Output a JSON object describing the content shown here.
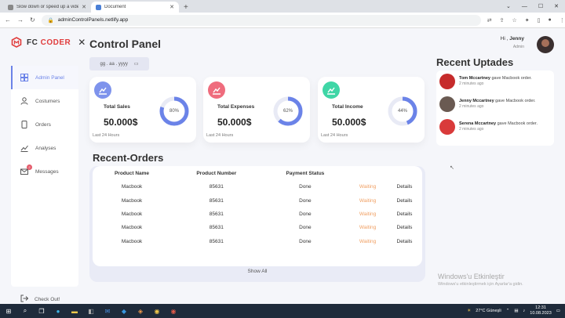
{
  "browser": {
    "tabs": [
      {
        "title": "Slow down or speed up a video"
      },
      {
        "title": "Document"
      }
    ],
    "url": "adminControlPanels.netlify.app"
  },
  "brand": {
    "name_main": "FC ",
    "name_accent": "CODER",
    "close": "✕"
  },
  "sidebar": {
    "items": [
      {
        "label": "Admin Panel"
      },
      {
        "label": "Costumers"
      },
      {
        "label": "Orders"
      },
      {
        "label": "Analyses"
      },
      {
        "label": "Messages",
        "badge": "2"
      }
    ],
    "checkout": "Check Out!"
  },
  "header": {
    "title": "Control Panel",
    "date_placeholder": "gg . aa . yyyy",
    "greeting": "Hi ,",
    "user_name": "Jenny",
    "user_role": "Admin"
  },
  "cards": [
    {
      "label": "Total Sales",
      "value": "50.000$",
      "percent": 80,
      "percent_text": "80%",
      "footer": "Last 24 Hours",
      "color": "#6b83e8",
      "icon_bg": "#7e93ec"
    },
    {
      "label": "Total Expenses",
      "value": "50.000$",
      "percent": 62,
      "percent_text": "62%",
      "footer": "Last 24 Hours",
      "color": "#6b83e8",
      "icon_bg": "#ef6c7d"
    },
    {
      "label": "Total Income",
      "value": "50.000$",
      "percent": 44,
      "percent_text": "44%",
      "footer": "Last 24 Hours",
      "color": "#6b83e8",
      "icon_bg": "#3fd6a6"
    }
  ],
  "orders": {
    "title": "Recent-Orders",
    "headers": [
      "Product Name",
      "Product Number",
      "Payment Status",
      "",
      ""
    ],
    "rows": [
      {
        "name": "Macbook",
        "number": "85631",
        "payment": "Done",
        "status": "Waiting",
        "action": "Details"
      },
      {
        "name": "Macbook",
        "number": "85631",
        "payment": "Done",
        "status": "Waiting",
        "action": "Details"
      },
      {
        "name": "Macbook",
        "number": "85631",
        "payment": "Done",
        "status": "Waiting",
        "action": "Details"
      },
      {
        "name": "Macbook",
        "number": "85631",
        "payment": "Done",
        "status": "Waiting",
        "action": "Details"
      },
      {
        "name": "Macbook",
        "number": "85631",
        "payment": "Done",
        "status": "Waiting",
        "action": "Details"
      }
    ],
    "show_all": "Show All"
  },
  "recent": {
    "title": "Recent Uptades",
    "updates": [
      {
        "name": "Tom Mccartney",
        "text": " gave Macbook order.",
        "time": "2 minutes ago"
      },
      {
        "name": "Jenny Mccartney",
        "text": " gave Macbook order.",
        "time": "2 minutes ago"
      },
      {
        "name": "Serena Mccartney",
        "text": " gave Macbook order.",
        "time": "2 minutes ago"
      }
    ]
  },
  "watermark": {
    "line1": "Windows'u Etkinleştir",
    "line2": "Windows'u etkinleştirmek için Ayarlar'a gidin."
  },
  "taskbar": {
    "weather": "27°C  Güneşli",
    "time": "12:31",
    "date": "10.08.2023"
  },
  "colors": {
    "accent": "#6b83e8",
    "warning": "#f0a064",
    "danger": "#e03c3c"
  }
}
